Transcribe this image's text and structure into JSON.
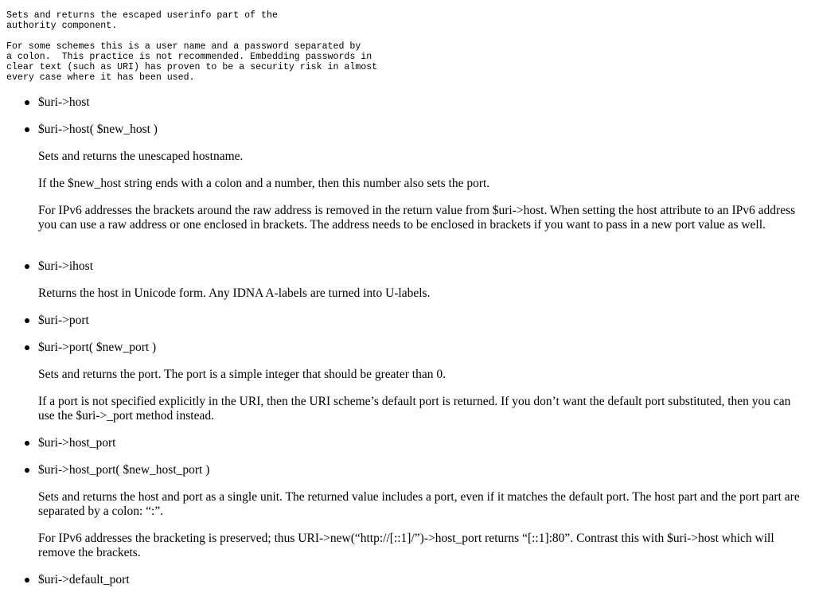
{
  "intro": {
    "pre1": "Sets and returns the escaped userinfo part of the\nauthority component.",
    "pre2": "For some schemes this is a user name and a password separated by\na colon.  This practice is not recommended. Embedding passwords in\nclear text (such as URI) has proven to be a security risk in almost\nevery case where it has been used."
  },
  "items": [
    {
      "label": "$uri->host"
    },
    {
      "label": "$uri->host( $new_host )",
      "paras": [
        "Sets and returns the unescaped hostname.",
        "If the $new_host string ends with a colon and a number, then this number also sets the port.",
        "For IPv6 addresses the brackets around the raw address is removed in the return value from $uri->host. When setting the host attribute to an IPv6 address you can use a raw address or one enclosed in brackets. The address needs to be enclosed in brackets if you want to pass in a new port value as well."
      ]
    },
    {
      "label": "$uri->ihost",
      "paras": [
        "Returns the host in Unicode form. Any IDNA A-labels are turned into U-labels."
      ]
    },
    {
      "label": "$uri->port"
    },
    {
      "label": "$uri->port( $new_port )",
      "paras": [
        "Sets and returns the port. The port is a simple integer that should be greater than 0.",
        "If a port is not specified explicitly in the URI, then the URI scheme’s default port is returned. If you don’t want the default port substituted, then you can use the $uri->_port method instead."
      ]
    },
    {
      "label": "$uri->host_port"
    },
    {
      "label": "$uri->host_port( $new_host_port )",
      "paras": [
        "Sets and returns the host and port as a single unit. The returned value includes a port, even if it matches the default port. The host part and the port part are separated by a colon: “:”.",
        "For IPv6 addresses the bracketing is preserved; thus URI->new(“http://[::1]/”)->host_port returns “[::1]:80”. Contrast this with $uri->host which will remove the brackets."
      ]
    },
    {
      "label": "$uri->default_port"
    }
  ]
}
